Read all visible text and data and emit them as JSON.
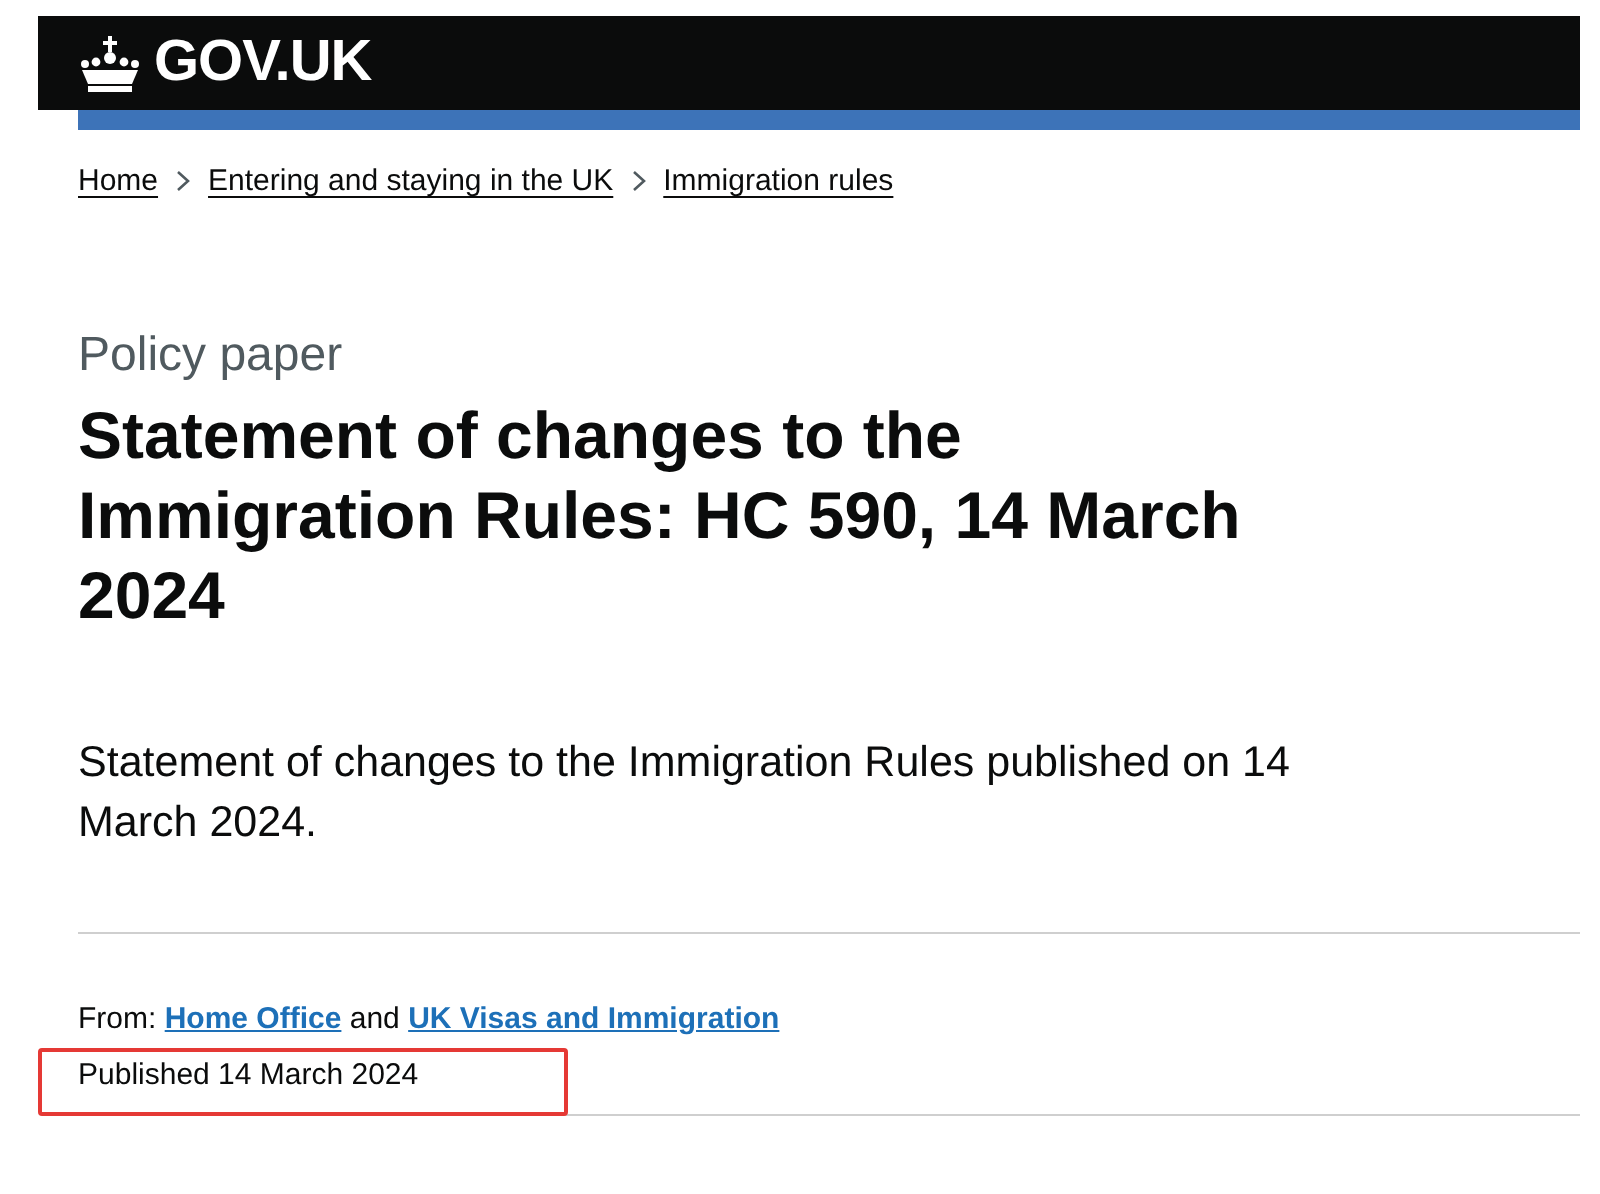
{
  "header": {
    "logo": "GOV.UK"
  },
  "breadcrumbs": [
    {
      "label": "Home"
    },
    {
      "label": "Entering and staying in the UK"
    },
    {
      "label": "Immigration rules"
    }
  ],
  "document_type": "Policy paper",
  "title": "Statement of changes to the Immigration Rules: HC 590, 14 March 2024",
  "summary": "Statement of changes to the Immigration Rules published on 14 March 2024.",
  "from": {
    "label": "From:",
    "organisations": [
      "Home Office",
      "UK Visas and Immigration"
    ],
    "joiner": "and"
  },
  "published": {
    "text": "Published 14 March 2024",
    "highlighted": true
  }
}
